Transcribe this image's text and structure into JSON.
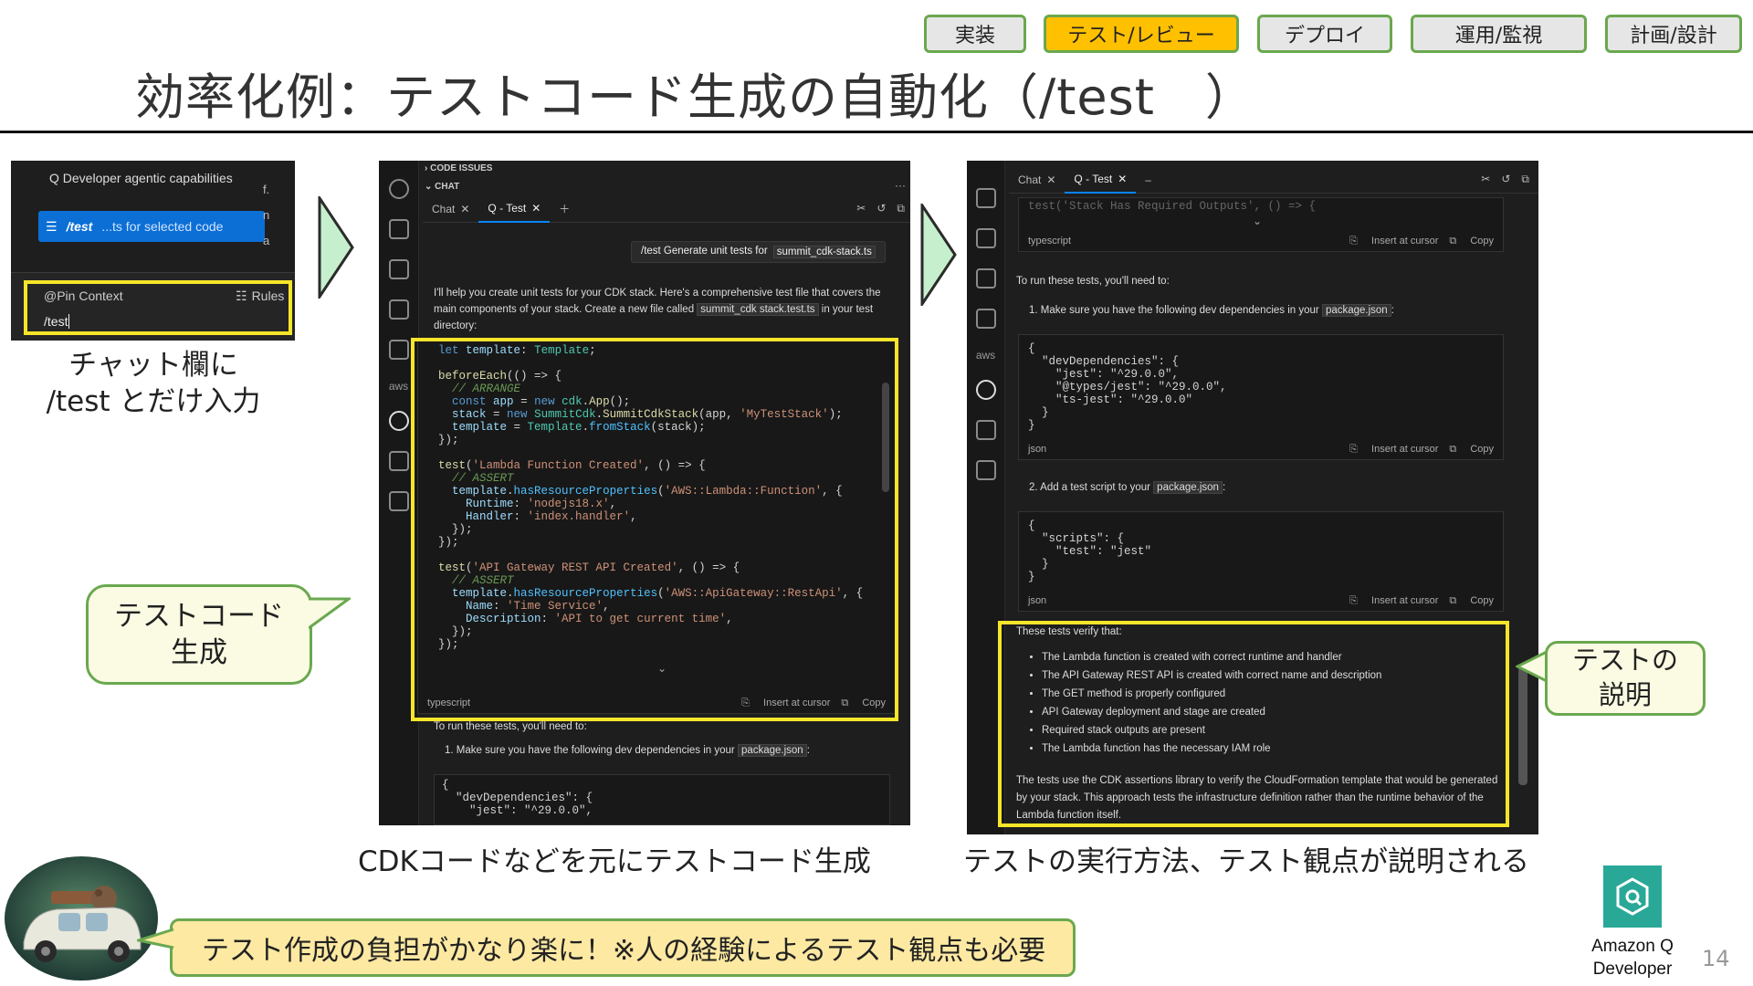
{
  "phases": [
    {
      "label": "実装",
      "active": false
    },
    {
      "label": "テスト/レビュー",
      "active": true
    },
    {
      "label": "デプロイ",
      "active": false
    },
    {
      "label": "運用/監視",
      "active": false
    },
    {
      "label": "計画/設計",
      "active": false
    }
  ],
  "title": "効率化例：テストコード生成の自動化（/test　）",
  "shot1": {
    "menu_heading": "Q Developer agentic capabilities",
    "command": "/test",
    "command_desc": "...ts for selected code",
    "pin_context": "@Pin Context",
    "rules": "Rules",
    "input_value": "/test",
    "right_edge": [
      "f.",
      "n",
      "a"
    ]
  },
  "caption1": "チャット欄に\n/test とだけ入力",
  "shot2": {
    "section1": "CODE ISSUES",
    "section2": "CHAT",
    "tabs": [
      "Chat",
      "Q - Test"
    ],
    "user_prompt": "/test Generate unit tests for",
    "user_prompt_file": "summit_cdk-stack.ts",
    "reply_intro_1": "I'll help you create unit tests for your CDK stack. Here's a comprehensive test file that covers the main components of your stack. Create a new file called",
    "reply_file": "summit_cdk stack.test.ts",
    "reply_intro_2": "in your test directory:",
    "code_lang": "typescript",
    "insert": "Insert at cursor",
    "copy": "Copy",
    "run_heading": "To run these tests, you'll need to:",
    "run_step1": "1. Make sure you have the following dev dependencies in your",
    "package_json": "package.json",
    "colon": ":",
    "tail_code": "{\n  \"devDependencies\": {\n    \"jest\": \"^29.0.0\","
  },
  "caption2": "CDKコードなどを元にテストコード生成",
  "callout_testcode": "テストコード\n生成",
  "shot3": {
    "tabs": [
      "Chat",
      "Q - Test"
    ],
    "top_code": "test('Stack Has Required Outputs', () => {",
    "lang_ts": "typescript",
    "lang_json": "json",
    "insert": "Insert at cursor",
    "copy": "Copy",
    "run_heading": "To run these tests, you'll need to:",
    "step1": "1. Make sure you have the following dev dependencies in your",
    "package_json": "package.json",
    "colon": ":",
    "step2": "2. Add a test script to your",
    "deps_code": "{\n  \"devDependencies\": {\n    \"jest\": \"^29.0.0\",\n    \"@types/jest\": \"^29.0.0\",\n    \"ts-jest\": \"^29.0.0\"\n  }\n}",
    "scripts_code": "{\n  \"scripts\": {\n    \"test\": \"jest\"\n  }\n}",
    "verify_heading": "These tests verify that:",
    "verify_items": [
      "The Lambda function is created with correct runtime and handler",
      "The API Gateway REST API is created with correct name and description",
      "The GET method is properly configured",
      "API Gateway deployment and stage are created",
      "Required stack outputs are present",
      "The Lambda function has the necessary IAM role"
    ],
    "summary": "The tests use the CDK assertions library to verify the CloudFormation template that would be generated by your stack. This approach tests the infrastructure definition rather than the runtime behavior of the Lambda function itself."
  },
  "caption3": "テストの実行方法、テスト観点が説明される",
  "callout_explain": "テストの\n説明",
  "bottom_note": "テスト作成の負担がかなり楽に！※人の経験によるテスト観点も必要",
  "logo_label": "Amazon Q\nDeveloper",
  "page_number": "14",
  "colors": {
    "accent_green": "#6aa84f",
    "highlight_yellow": "#f7e52a",
    "active_phase": "#ffc000",
    "logo_teal": "#2aa897"
  }
}
